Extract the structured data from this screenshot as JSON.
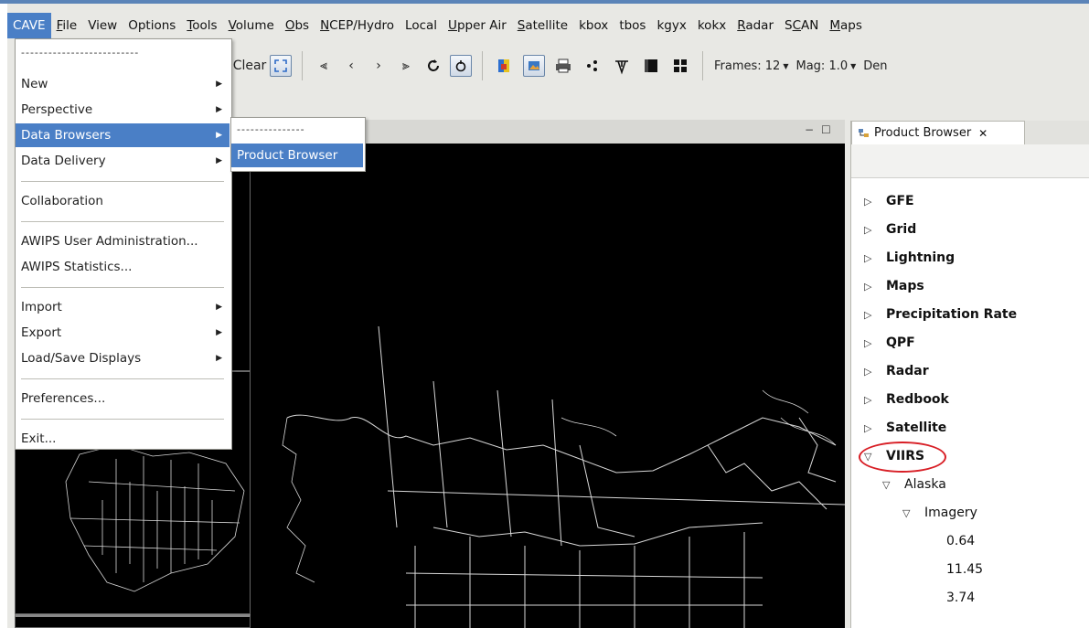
{
  "menubar": {
    "items": [
      {
        "label": "CAVE",
        "active": true
      },
      {
        "label": "File",
        "ul": "F"
      },
      {
        "label": "View"
      },
      {
        "label": "Options"
      },
      {
        "label": "Tools",
        "ul": "T"
      },
      {
        "label": "Volume",
        "ul": "V"
      },
      {
        "label": "Obs",
        "ul": "O"
      },
      {
        "label": "NCEP/Hydro",
        "ul": "N"
      },
      {
        "label": "Local"
      },
      {
        "label": "Upper Air",
        "ul": "U"
      },
      {
        "label": "Satellite",
        "ul": "S"
      },
      {
        "label": "kbox"
      },
      {
        "label": "tbos"
      },
      {
        "label": "kgyx"
      },
      {
        "label": "kokx"
      },
      {
        "label": "Radar",
        "ul": "R"
      },
      {
        "label": "SCAN",
        "ul": "C"
      },
      {
        "label": "Maps",
        "ul": "M"
      }
    ]
  },
  "toolbar": {
    "clear_label": "Clear",
    "frames_label": "Frames: 12",
    "mag_label": "Mag: 1.0",
    "den_label": "Den",
    "icons": [
      "first-frame-icon",
      "prev-frame-icon",
      "next-frame-icon",
      "last-frame-icon",
      "loop-icon",
      "refresh-icon",
      "color-table-icon",
      "image-icon",
      "print-icon",
      "points-icon",
      "sample-icon",
      "panel-icon",
      "panels-icon"
    ]
  },
  "cave_menu": {
    "tearoff": "--------------------------",
    "items": [
      {
        "label": "New",
        "submenu": true
      },
      {
        "label": "Perspective",
        "submenu": true
      },
      {
        "label": "Data Browsers",
        "submenu": true,
        "highlighted": true
      },
      {
        "label": "Data Delivery",
        "submenu": true
      },
      {
        "label": "Collaboration",
        "submenu": false
      },
      {
        "label": "AWIPS User Administration...",
        "submenu": false
      },
      {
        "label": "AWIPS Statistics...",
        "submenu": false
      },
      {
        "label": "Import",
        "submenu": true
      },
      {
        "label": "Export",
        "submenu": true
      },
      {
        "label": "Load/Save Displays",
        "submenu": true
      },
      {
        "label": "Preferences...",
        "submenu": false
      },
      {
        "label": "Exit...",
        "submenu": false
      }
    ]
  },
  "browsers_submenu": {
    "tearoff": "---------------",
    "items": [
      {
        "label": "Product Browser",
        "highlighted": true
      }
    ]
  },
  "product_browser": {
    "tab_label": "Product Browser",
    "tree": [
      {
        "label": "GFE",
        "level": 0,
        "expanded": false,
        "bold": true
      },
      {
        "label": "Grid",
        "level": 0,
        "expanded": false,
        "bold": true
      },
      {
        "label": "Lightning",
        "level": 0,
        "expanded": false,
        "bold": true
      },
      {
        "label": "Maps",
        "level": 0,
        "expanded": false,
        "bold": true
      },
      {
        "label": "Precipitation Rate",
        "level": 0,
        "expanded": false,
        "bold": true
      },
      {
        "label": "QPF",
        "level": 0,
        "expanded": false,
        "bold": true
      },
      {
        "label": "Radar",
        "level": 0,
        "expanded": false,
        "bold": true
      },
      {
        "label": "Redbook",
        "level": 0,
        "expanded": false,
        "bold": true
      },
      {
        "label": "Satellite",
        "level": 0,
        "expanded": false,
        "bold": true
      },
      {
        "label": "VIIRS",
        "level": 0,
        "expanded": true,
        "bold": true,
        "circled": true
      },
      {
        "label": "Alaska",
        "level": 1,
        "expanded": true,
        "bold": false
      },
      {
        "label": "Imagery",
        "level": 2,
        "expanded": true,
        "bold": false
      },
      {
        "label": "0.64",
        "level": 3,
        "leaf": true,
        "bold": false
      },
      {
        "label": "11.45",
        "level": 3,
        "leaf": true,
        "bold": false
      },
      {
        "label": "3.74",
        "level": 3,
        "leaf": true,
        "bold": false
      }
    ]
  },
  "colors": {
    "highlight": "#4a7fc6",
    "annotation_circle": "#d81f26",
    "map_background": "#000000",
    "map_lines": "#d8d8d8"
  }
}
